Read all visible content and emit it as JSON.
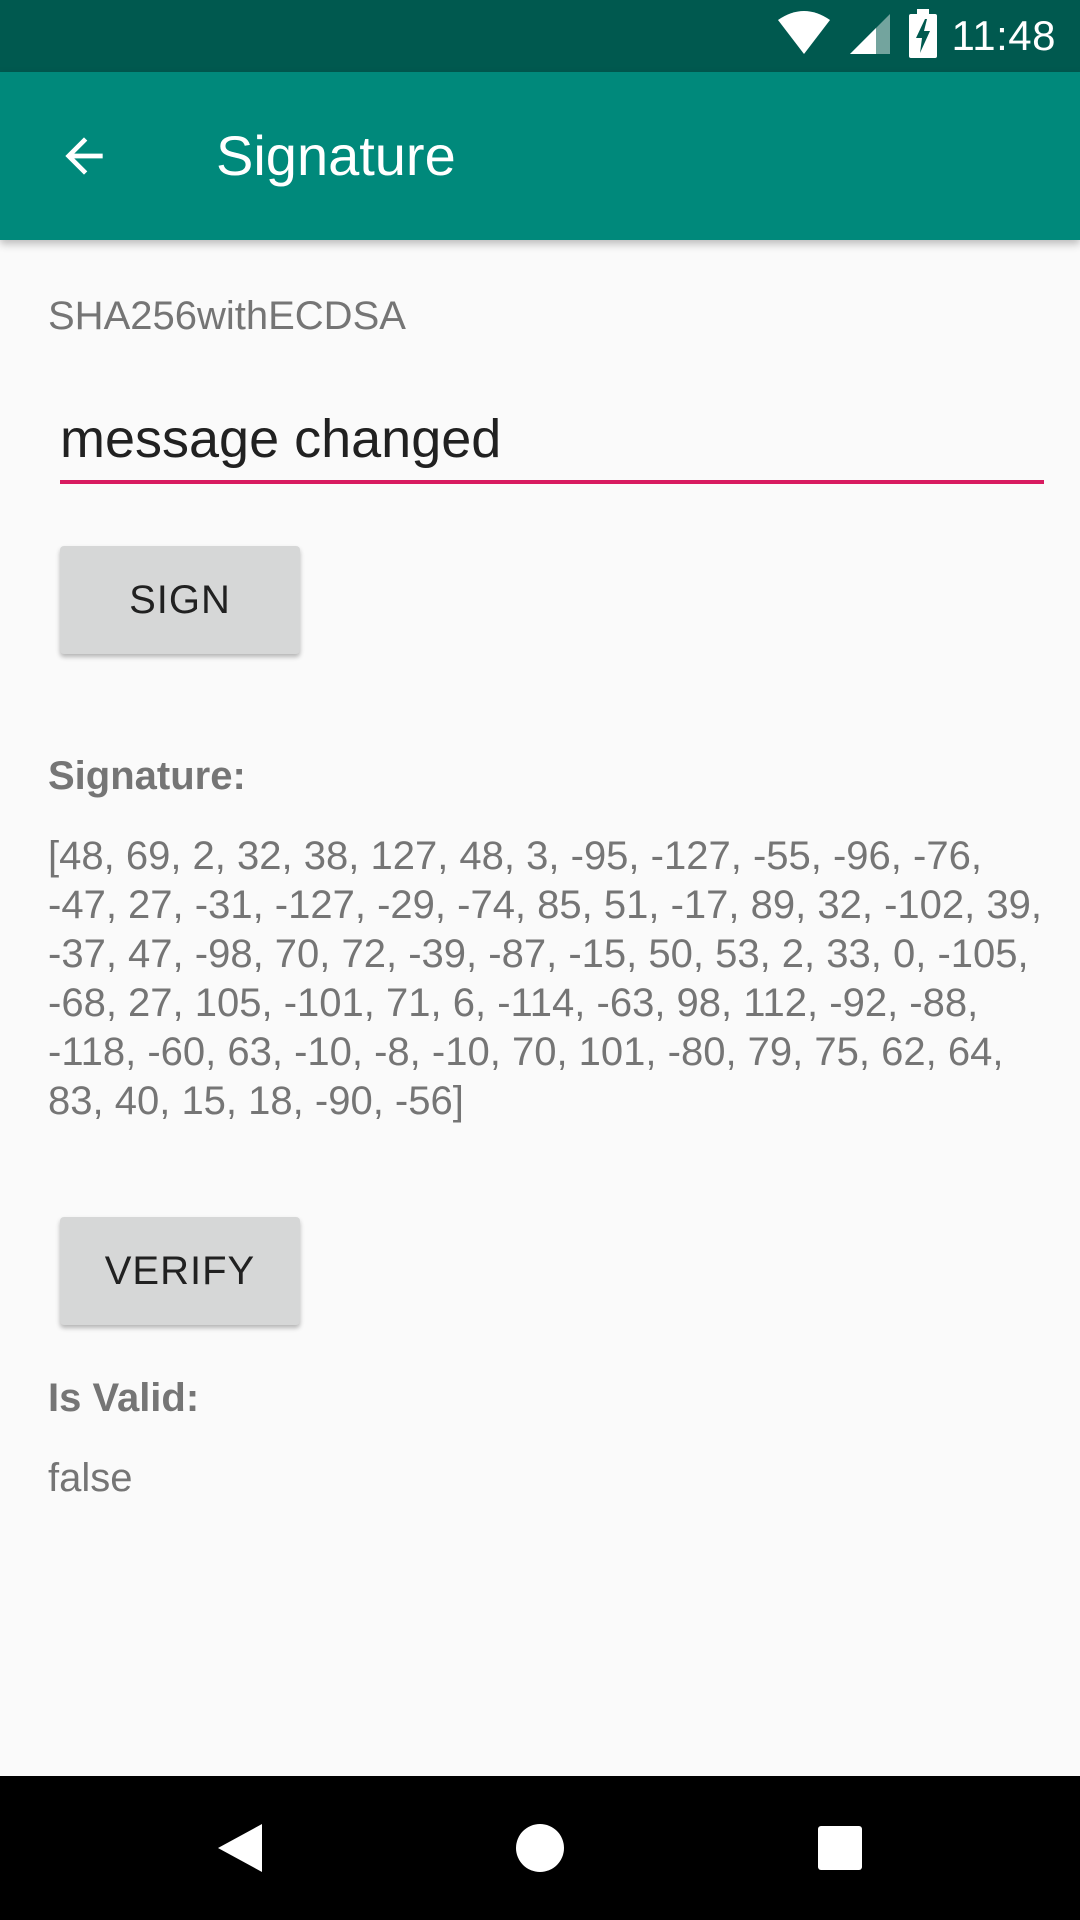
{
  "status_bar": {
    "time": "11:48",
    "icons": [
      "wifi-icon",
      "cell-signal-icon",
      "battery-charging-icon"
    ]
  },
  "toolbar": {
    "title": "Signature",
    "back_icon": "arrow-back-icon"
  },
  "main": {
    "algorithm": "SHA256withECDSA",
    "message_input": {
      "value": "message changed"
    },
    "sign_button": "SIGN",
    "signature_label": "Signature:",
    "signature_value": "[48, 69, 2, 32, 38, 127, 48, 3, -95, -127, -55, -96, -76, -47, 27, -31, -127, -29, -74, 85, 51, -17, 89, 32, -102, 39, -37, 47, -98, 70, 72, -39, -87, -15, 50, 53, 2, 33, 0, -105, -68, 27, 105, -101, 71, 6, -114, -63, 98, 112, -92, -88, -118, -60, 63, -10, -8, -10, 70, 101, -80, 79, 75, 62, 64, 83, 40, 15, 18, -90, -56]",
    "verify_button": "VERIFY",
    "valid_label": "Is Valid:",
    "valid_value": "false"
  },
  "nav_bar": {
    "icons": [
      "nav-back-icon",
      "nav-home-icon",
      "nav-recents-icon"
    ]
  },
  "colors": {
    "status_bar": "#00594f",
    "toolbar": "#00897b",
    "input_underline": "#d81b60",
    "button": "#d6d7d7"
  }
}
